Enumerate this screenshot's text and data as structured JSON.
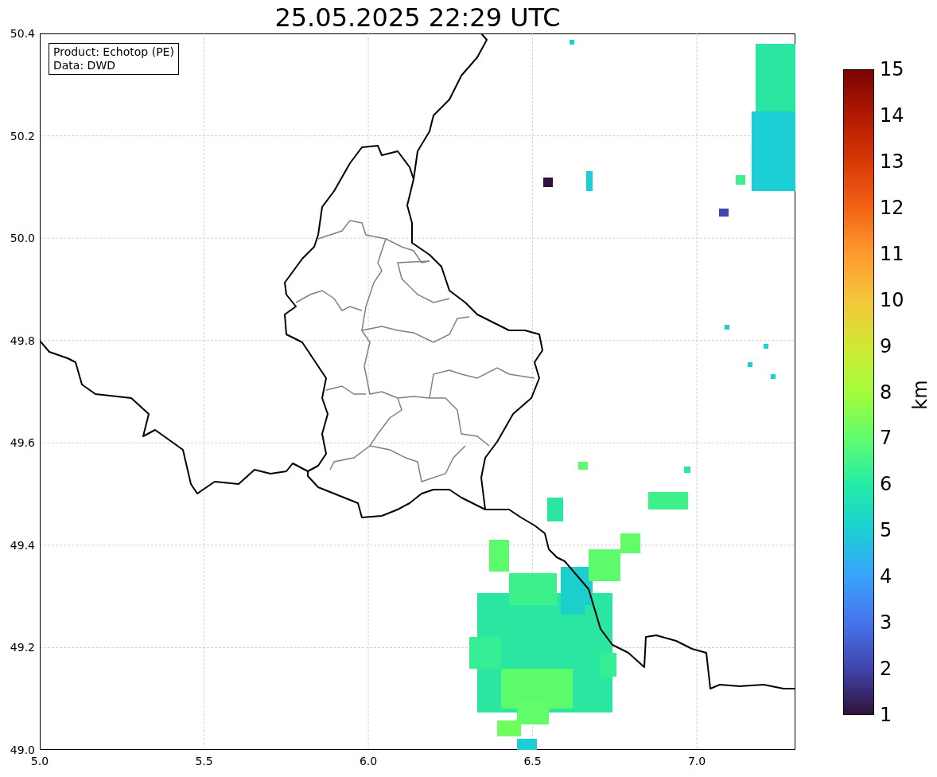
{
  "title": "25.05.2025 22:29 UTC",
  "info_box": [
    "Product: Echotop (PE)",
    "Data: DWD"
  ],
  "y_ticks": [
    "50.4",
    "50.2",
    "50.0",
    "49.8",
    "49.6",
    "49.4",
    "49.2",
    "49.0"
  ],
  "x_ticks": [
    "5.0",
    "5.5",
    "6.0",
    "6.5",
    "7.0"
  ],
  "colorbar": {
    "ticks": [
      "15",
      "14",
      "13",
      "12",
      "11",
      "10",
      "9",
      "8",
      "7",
      "6",
      "5",
      "4",
      "3",
      "2",
      "1"
    ],
    "label": "km"
  }
}
